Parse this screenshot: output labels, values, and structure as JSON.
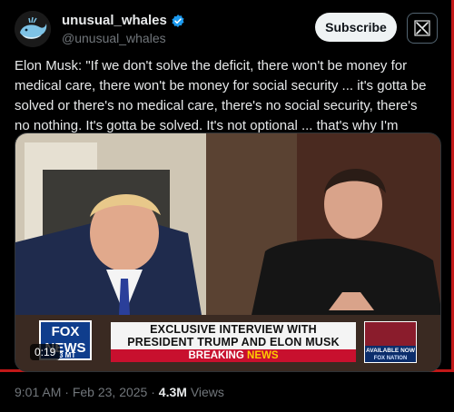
{
  "author": {
    "display_name": "unusual_whales",
    "handle": "@unusual_whales",
    "verified": true,
    "avatar_icon": "whale-logo-icon"
  },
  "actions": {
    "subscribe_label": "Subscribe",
    "grok_icon": "grok-icon"
  },
  "tweet": {
    "text": "Elon Musk: \"If we don't solve the deficit, there won't be money for medical care, there won't be money for social security ... it's gotta be solved or there's no medical care, there's no social security, there's no nothing. It's gotta be solved. It's not optional ... that's why I'm here.\""
  },
  "media": {
    "headline_line1": "EXCLUSIVE INTERVIEW WITH",
    "headline_line2": "PRESIDENT TRUMP AND ELON MUSK",
    "breaking_prefix": "BREAKING",
    "breaking_suffix": "NEWS",
    "network_logo_line1": "FOX",
    "network_logo_line2": "NEWS",
    "time_zone": "3 MT",
    "timecode": "0:19",
    "badge_available": "AVAILABLE NOW",
    "badge_brand": "FOX NATION"
  },
  "meta": {
    "time": "9:01 AM",
    "date": "Feb 23, 2025",
    "views_count": "4.3M",
    "views_label": "Views"
  },
  "colors": {
    "background": "#000000",
    "text": "#e7e9ea",
    "muted": "#71767b",
    "verified_blue": "#1d9bf0",
    "breaking_red": "#c8102e",
    "frame_red": "#c21818"
  }
}
